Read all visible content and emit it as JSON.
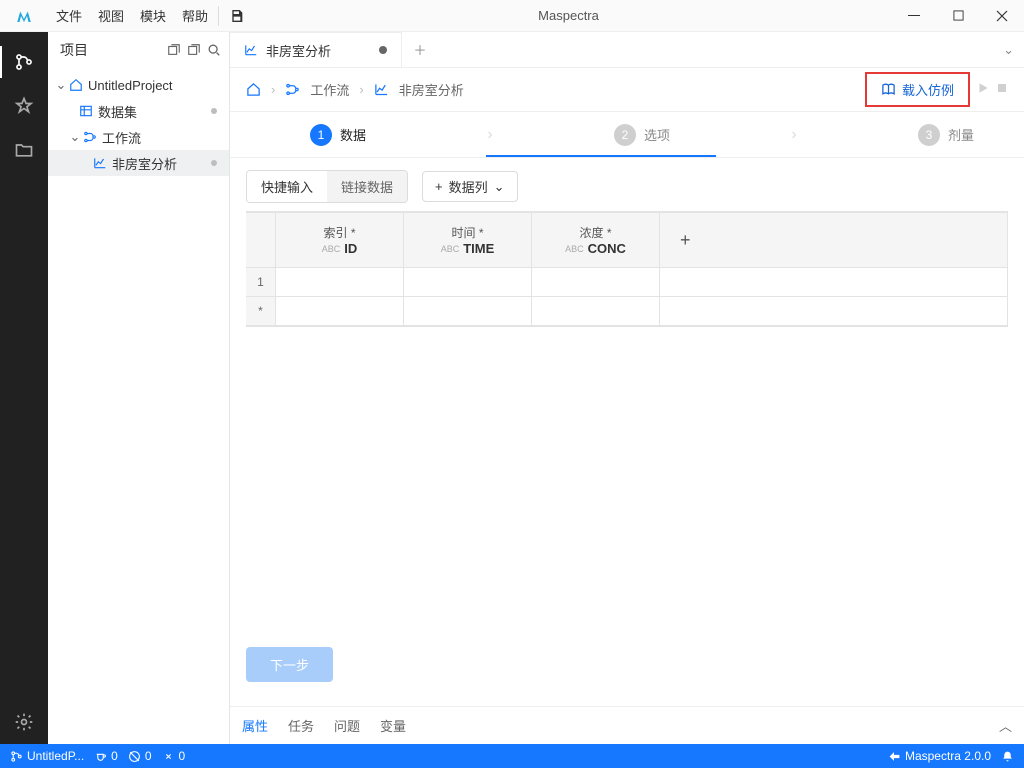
{
  "app": {
    "title": "Maspectra"
  },
  "menu": {
    "file": "文件",
    "view": "视图",
    "module": "模块",
    "help": "帮助"
  },
  "sidebar": {
    "title": "项目",
    "project": "UntitledProject",
    "dataset": "数据集",
    "workflow": "工作流",
    "nca": "非房室分析"
  },
  "tab": {
    "label": "非房室分析"
  },
  "breadcrumb": {
    "workflow": "工作流",
    "nca": "非房室分析"
  },
  "action": {
    "load_example": "载入仿例"
  },
  "steps": {
    "s1": "数据",
    "s2": "选项",
    "s3": "剂量"
  },
  "data": {
    "quick_input": "快捷输入",
    "link_data": "链接数据",
    "data_col": "数据列",
    "col_index_label": "索引 *",
    "col_index": "ID",
    "col_time_label": "时间 *",
    "col_time": "TIME",
    "col_conc_label": "浓度 *",
    "col_conc": "CONC",
    "row1": "1",
    "rownew": "*"
  },
  "next": "下一步",
  "bottom": {
    "attr": "属性",
    "task": "任务",
    "issue": "问题",
    "var": "变量"
  },
  "status": {
    "project": "UntitledP...",
    "zero1": "0",
    "zero2": "0",
    "zero3": "0",
    "version": "Maspectra 2.0.0"
  }
}
